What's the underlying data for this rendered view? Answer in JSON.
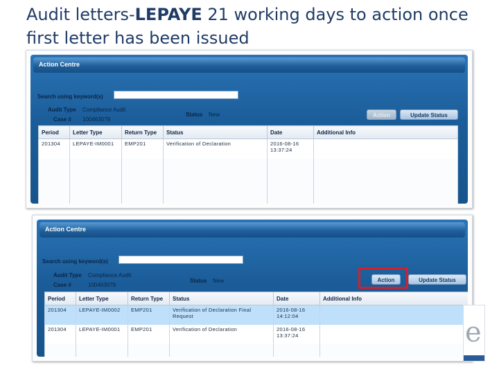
{
  "slide": {
    "title_prefix": "Audit letters-",
    "title_bold": "LEPAYE",
    "title_suffix": " 21 working days to action once first letter has been issued"
  },
  "panels": [
    {
      "header": "Action Centre",
      "search_label": "Search using keyword(s)",
      "audit_type_label": "Audit Type",
      "audit_type_value": "Compliance Audit",
      "case_label": "Case #",
      "case_value": "100463078",
      "status_label": "Status",
      "status_value": "New",
      "action_button": "Action",
      "update_button": "Update Status",
      "columns": [
        "Period",
        "Letter Type",
        "Return Type",
        "Status",
        "Date",
        "Additional Info"
      ],
      "rows": [
        [
          "201304",
          "LEPAYE-IM0001",
          "EMP201",
          "Verification of Declaration",
          "2016-08-16\n13:37:24",
          ""
        ]
      ]
    },
    {
      "header": "Action Centre",
      "search_label": "Search using keyword(s)",
      "audit_type_label": "Audit Type",
      "audit_type_value": "Compliance Audit",
      "case_label": "Case #",
      "case_value": "100463078",
      "status_label": "Status",
      "status_value": "New",
      "action_button": "Action",
      "update_button": "Update Status",
      "columns": [
        "Period",
        "Letter Type",
        "Return Type",
        "Status",
        "Date",
        "Additional Info"
      ],
      "rows": [
        [
          "201304",
          "LEPAYE-IM0002",
          "EMP201",
          "Verification of Declaration Final Request",
          "2016-08-16\n14:12:04",
          ""
        ],
        [
          "201304",
          "LEPAYE-IM0001",
          "EMP201",
          "Verification of Declaration",
          "2016-08-16\n13:37:24",
          ""
        ]
      ]
    }
  ],
  "colors": {
    "title": "#1f3b66",
    "panel_blue": "#1b5d99",
    "highlight": "#d3202b",
    "selected_row": "#bfe0fb"
  },
  "icons": [
    "logo-fragment-icon"
  ]
}
